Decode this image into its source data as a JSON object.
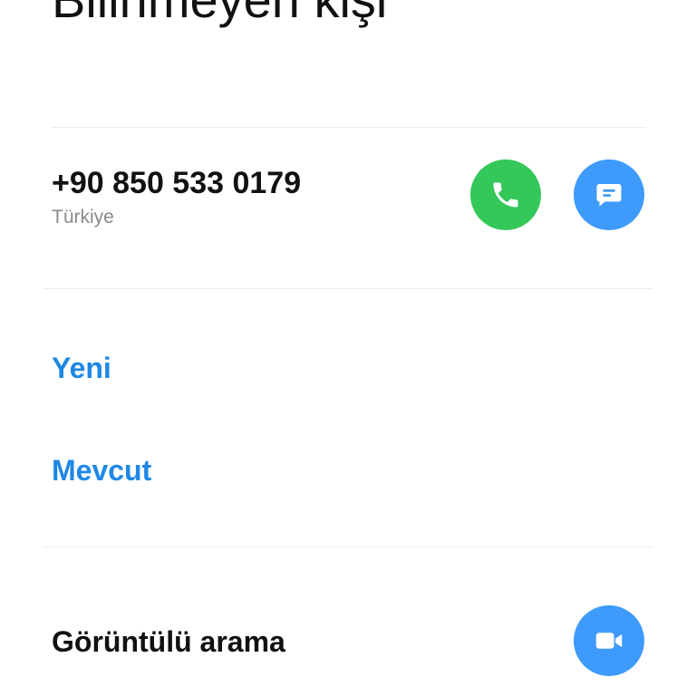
{
  "header": {
    "title": "Bilinmeyen kişi"
  },
  "number_section": {
    "number": "+90 850 533 0179",
    "country": "Türkiye",
    "call_icon": "phone-icon",
    "message_icon": "message-icon"
  },
  "add_contact": {
    "new_label": "Yeni",
    "existing_label": "Mevcut"
  },
  "video_section": {
    "label": "Görüntülü arama",
    "icon": "video-camera-icon"
  },
  "colors": {
    "call_green": "#34C759",
    "action_blue": "#3E9BFB",
    "link_blue": "#1E88E5",
    "secondary_text": "#8A8A8A"
  }
}
